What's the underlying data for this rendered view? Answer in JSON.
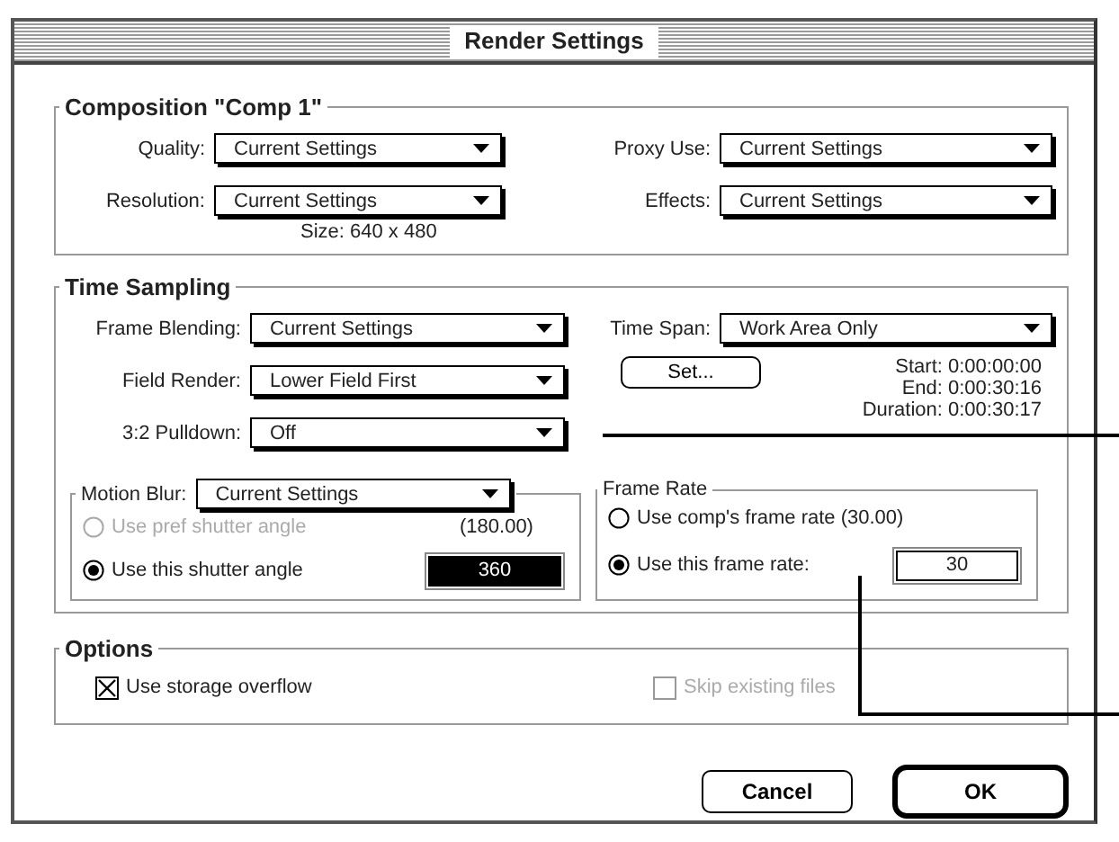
{
  "window": {
    "title": "Render Settings"
  },
  "composition": {
    "title": "Composition \"Comp 1\"",
    "fields": [
      {
        "label": "Quality:",
        "value": "Current Settings"
      },
      {
        "label": "Proxy Use:",
        "value": "Current Settings"
      },
      {
        "label": "Resolution:",
        "value": "Current Settings"
      },
      {
        "label": "Effects:",
        "value": "Current Settings"
      }
    ],
    "size": "Size: 640 x 480"
  },
  "time_sampling": {
    "title": "Time Sampling",
    "fields": [
      {
        "label": "Frame Blending:",
        "value": "Current Settings"
      },
      {
        "label": "Field Render:",
        "value": "Lower Field First"
      },
      {
        "label": "3:2 Pulldown:",
        "value": "Off"
      }
    ],
    "time_span": {
      "label": "Time Span:",
      "value": "Work Area Only"
    },
    "set_button": "Set...",
    "readouts": [
      "Start: 0:00:00:00",
      "End: 0:00:30:16",
      "Duration: 0:00:30:17"
    ],
    "motion_blur": {
      "label": "Motion Blur:",
      "value": "Current Settings",
      "options": [
        {
          "label": "Use pref shutter angle",
          "selected": false,
          "disabled": true,
          "reading": "(180.00)"
        },
        {
          "label": "Use this shutter angle",
          "selected": true,
          "disabled": false,
          "value": "360"
        }
      ]
    },
    "frame_rate": {
      "title": "Frame Rate",
      "options": [
        {
          "label": "Use comp's frame rate (30.00)",
          "selected": false,
          "disabled": false
        },
        {
          "label": "Use this frame rate:",
          "selected": true,
          "disabled": false,
          "value": "30"
        }
      ]
    }
  },
  "options": {
    "title": "Options",
    "checkboxes": [
      {
        "label": "Use storage overflow",
        "checked": true,
        "disabled": false
      },
      {
        "label": "Skip existing files",
        "checked": false,
        "disabled": true
      }
    ]
  },
  "buttons": [
    {
      "label": "Cancel",
      "kind": "normal"
    },
    {
      "label": "OK",
      "kind": "default"
    }
  ]
}
